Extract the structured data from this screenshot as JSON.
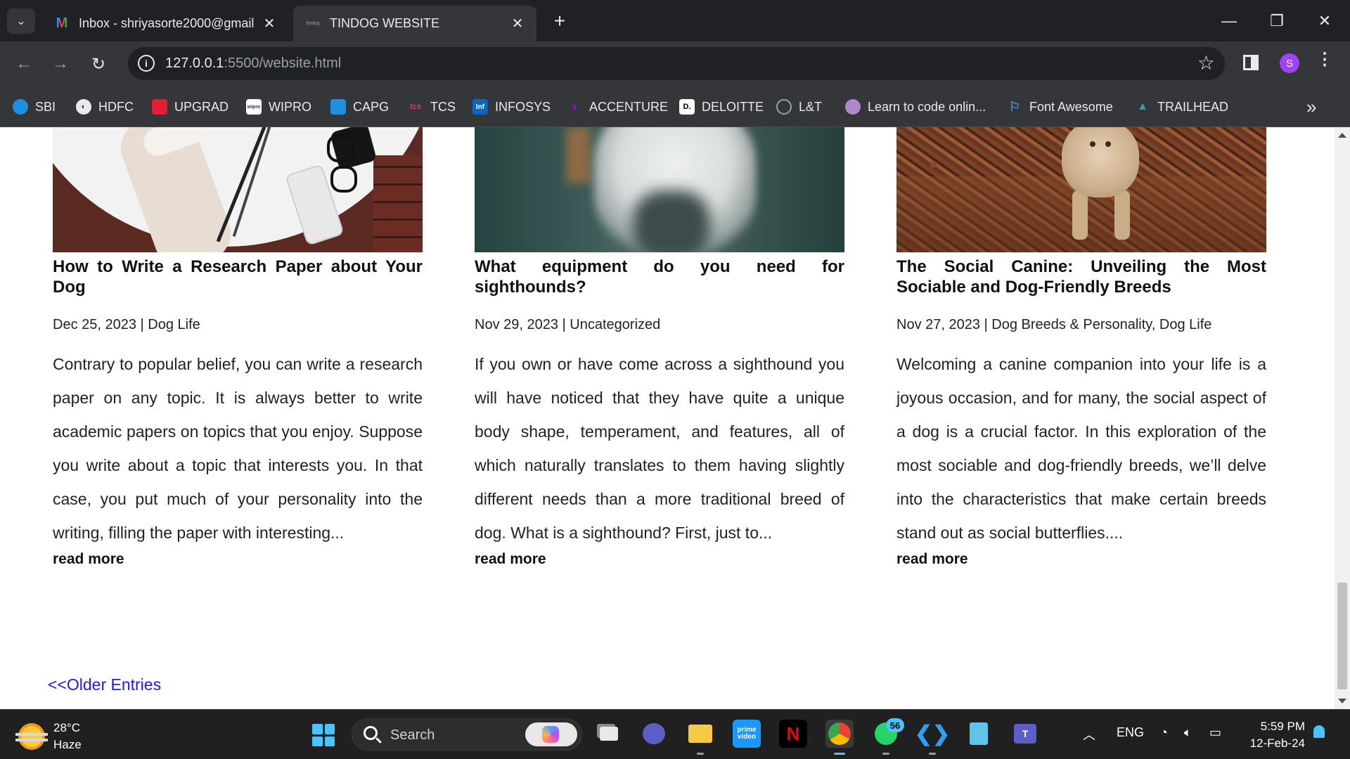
{
  "browser": {
    "tabs": [
      {
        "title": "Inbox - shriyasorte2000@gmail",
        "active": false,
        "icon": "gmail-icon"
      },
      {
        "title": "TINDOG WEBSITE",
        "active": true,
        "icon": "tindog-icon"
      }
    ],
    "url_host": "127.0.0.1",
    "url_path": ":5500/website.html",
    "profile_initial": "S",
    "bookmarks": [
      {
        "label": "SBI",
        "icon": "sbi-icon",
        "color": "#1f8fe0"
      },
      {
        "label": "HDFC",
        "icon": "hdfc-icon",
        "color": "#e8eaed"
      },
      {
        "label": "UPGRAD",
        "icon": "upgrad-icon",
        "color": "#e01e37"
      },
      {
        "label": "WIPRO",
        "icon": "wipro-icon",
        "color": "#ffffff"
      },
      {
        "label": "CAPG",
        "icon": "capgemini-icon",
        "color": "#1f8fe0"
      },
      {
        "label": "TCS",
        "icon": "tcs-icon",
        "color": "#e23c5b"
      },
      {
        "label": "INFOSYS",
        "icon": "infosys-icon",
        "color": "#0a66c2"
      },
      {
        "label": "ACCENTURE",
        "icon": "accenture-icon",
        "color": "#a100ff"
      },
      {
        "label": "DELOITTE",
        "icon": "deloitte-icon",
        "color": "#ffffff"
      },
      {
        "label": "L&T",
        "icon": "lt-icon",
        "color": "#e8eaed"
      },
      {
        "label": "Learn to code onlin...",
        "icon": "avatar-icon",
        "color": "#b088c9"
      },
      {
        "label": "Font Awesome",
        "icon": "flag-icon",
        "color": "#4a90e2"
      },
      {
        "label": "TRAILHEAD",
        "icon": "trailhead-icon",
        "color": "#2ca6a4"
      }
    ]
  },
  "posts": [
    {
      "title": "How to Write a Research Paper about Your Dog",
      "date": "Dec 25, 2023",
      "categories": "Dog Life",
      "excerpt": "Contrary to popular belief, you can write a research paper on any topic. It is always better to write academic papers on topics that you enjoy. Suppose you write about a topic that interests you. In that case, you put much of your personality into the writing, filling the paper with interesting...",
      "read_more": "read more"
    },
    {
      "title": "What equipment do you need for sighthounds?",
      "date": "Nov 29, 2023",
      "categories": "Uncategorized",
      "excerpt": "If you own or have come across a sighthound you will have noticed that they have quite a unique body shape, temperament, and features, all of which naturally translates to them having slightly different needs than a more traditional breed of dog. What is a sighthound? First, just to...",
      "read_more": "read more"
    },
    {
      "title": "The Social Canine: Unveiling the Most Sociable and Dog-Friendly Breeds",
      "date": "Nov 27, 2023",
      "categories": "Dog Breeds & Personality, Dog Life",
      "excerpt": "Welcoming a canine companion into your life is a joyous occasion, and for many, the social aspect of a dog is a crucial factor. In this exploration of the most sociable and dog-friendly breeds, we’ll delve into the characteristics that make certain breeds stand out as social butterflies....",
      "read_more": "read more"
    }
  ],
  "pagination": {
    "older": "<<Older Entries"
  },
  "taskbar": {
    "temperature": "28°C",
    "condition": "Haze",
    "search_label": "Search",
    "whatsapp_badge": "56",
    "language": "ENG",
    "time": "5:59 PM",
    "date": "12-Feb-24"
  }
}
